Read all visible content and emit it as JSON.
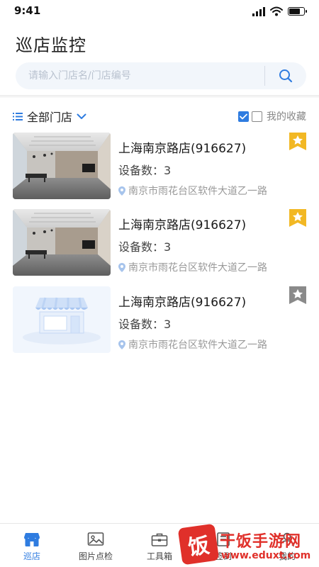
{
  "status_bar": {
    "time": "9:41"
  },
  "header": {
    "title": "巡店监控",
    "search_placeholder": "请输入门店名/门店编号"
  },
  "filter": {
    "store_filter_label": "全部门店",
    "favorites_label": "我的收藏"
  },
  "stores": [
    {
      "name": "上海南京路店(916627)",
      "device_count_label": "设备数：",
      "device_count": "3",
      "address": "南京市雨花台区软件大道乙一路",
      "favorited": true,
      "thumbnail": "office-photo"
    },
    {
      "name": "上海南京路店(916627)",
      "device_count_label": "设备数：",
      "device_count": "3",
      "address": "南京市雨花台区软件大道乙一路",
      "favorited": true,
      "thumbnail": "office-photo"
    },
    {
      "name": "上海南京路店(916627)",
      "device_count_label": "设备数：",
      "device_count": "3",
      "address": "南京市雨花台区软件大道乙一路",
      "favorited": false,
      "thumbnail": "storefront-placeholder"
    }
  ],
  "tabs": [
    {
      "label": "巡店",
      "icon": "store-icon",
      "active": true
    },
    {
      "label": "图片点检",
      "icon": "image-icon",
      "active": false
    },
    {
      "label": "工具箱",
      "icon": "toolbox-icon",
      "active": false
    },
    {
      "label": "签到",
      "icon": "checkin-icon",
      "active": false
    },
    {
      "label": "我的",
      "icon": "profile-icon",
      "active": false
    }
  ],
  "watermark": {
    "seal_char": "饭",
    "title": "干饭手游网",
    "url": "www.eduxt.com"
  },
  "colors": {
    "accent": "#2f7ce0",
    "star_active": "#f2b824",
    "star_inactive": "#8a8a8a",
    "watermark": "#e0302a"
  }
}
